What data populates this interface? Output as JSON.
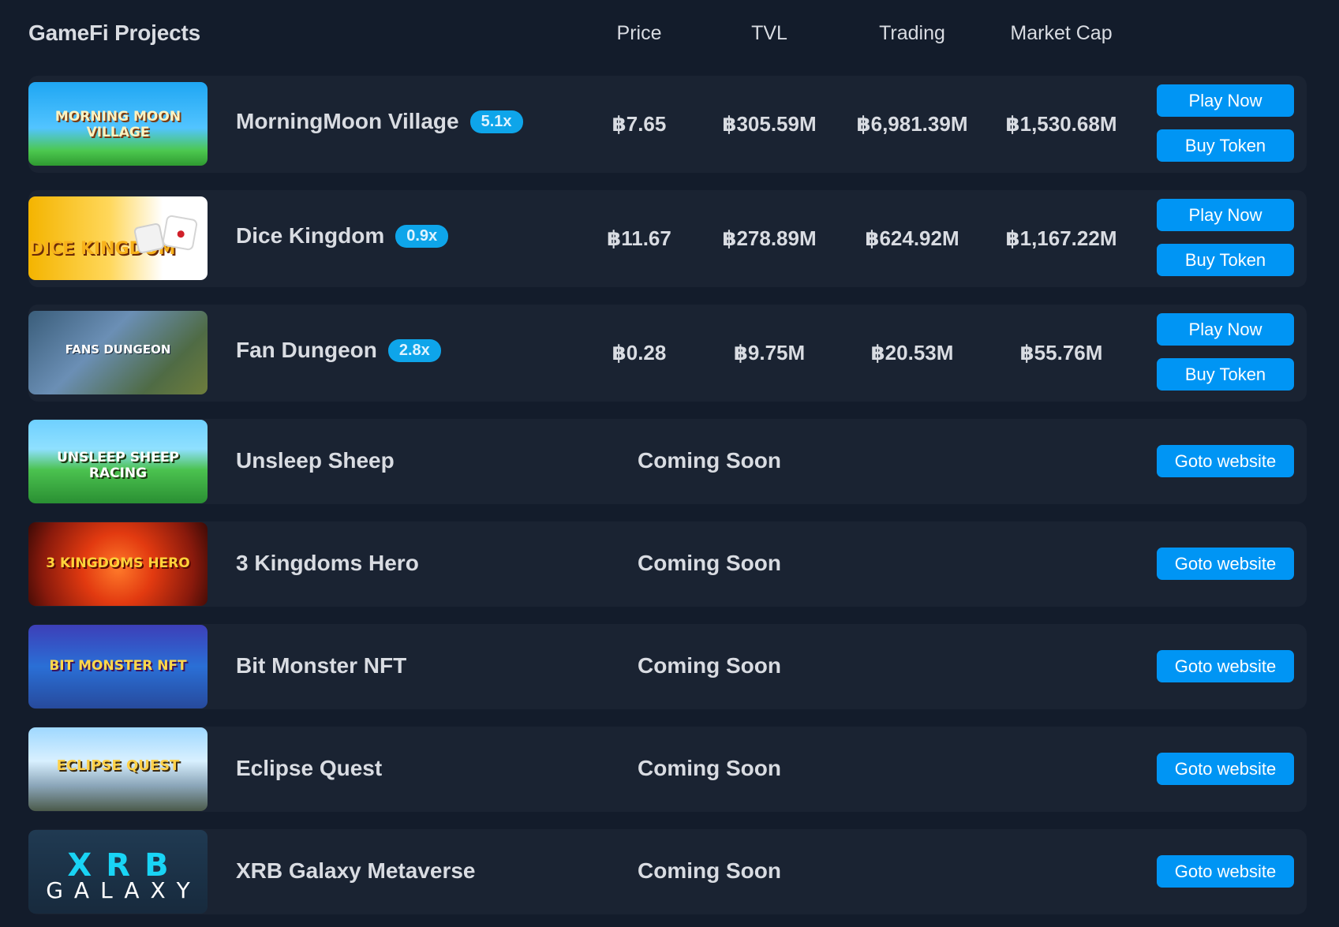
{
  "header": {
    "title": "GameFi Projects",
    "col_price": "Price",
    "col_tvl": "TVL",
    "col_trading": "Trading",
    "col_mcap": "Market Cap"
  },
  "live_projects": [
    {
      "name": "MorningMoon Village",
      "multiplier": "5.1x",
      "price": "฿7.65",
      "tvl": "฿305.59M",
      "trading": "฿6,981.39M",
      "market_cap": "฿1,530.68M",
      "play_label": "Play Now",
      "buy_label": "Buy Token"
    },
    {
      "name": "Dice Kingdom",
      "multiplier": "0.9x",
      "price": "฿11.67",
      "tvl": "฿278.89M",
      "trading": "฿624.92M",
      "market_cap": "฿1,167.22M",
      "play_label": "Play Now",
      "buy_label": "Buy Token"
    },
    {
      "name": "Fan Dungeon",
      "multiplier": "2.8x",
      "price": "฿0.28",
      "tvl": "฿9.75M",
      "trading": "฿20.53M",
      "market_cap": "฿55.76M",
      "play_label": "Play Now",
      "buy_label": "Buy Token"
    }
  ],
  "upcoming_projects": [
    {
      "name": "Unsleep Sheep",
      "status": "Coming Soon",
      "button_label": "Goto website"
    },
    {
      "name": "3 Kingdoms Hero",
      "status": "Coming Soon",
      "button_label": "Goto website"
    },
    {
      "name": "Bit Monster NFT",
      "status": "Coming Soon",
      "button_label": "Goto website"
    },
    {
      "name": "Eclipse Quest",
      "status": "Coming Soon",
      "button_label": "Goto website"
    },
    {
      "name": "XRB Galaxy Metaverse",
      "status": "Coming Soon",
      "button_label": "Goto website"
    }
  ],
  "thumbnail_art_text": {
    "morningmoon": "MORNING MOON VILLAGE",
    "dice": "DICE KINGDOM",
    "fan": "FANS DUNGEON",
    "sheep": "UNSLEEP SHEEP RACING",
    "kingdoms": "3 KINGDOMS HERO",
    "bit": "BIT MONSTER NFT",
    "eclipse": "ECLIPSE QUEST",
    "xrb_top": "XRB",
    "xrb_bottom": "GALAXY"
  },
  "colors": {
    "background": "#131c2b",
    "row_background": "#1a2332",
    "accent_button": "#0095f4",
    "badge": "#0ea5ea"
  }
}
